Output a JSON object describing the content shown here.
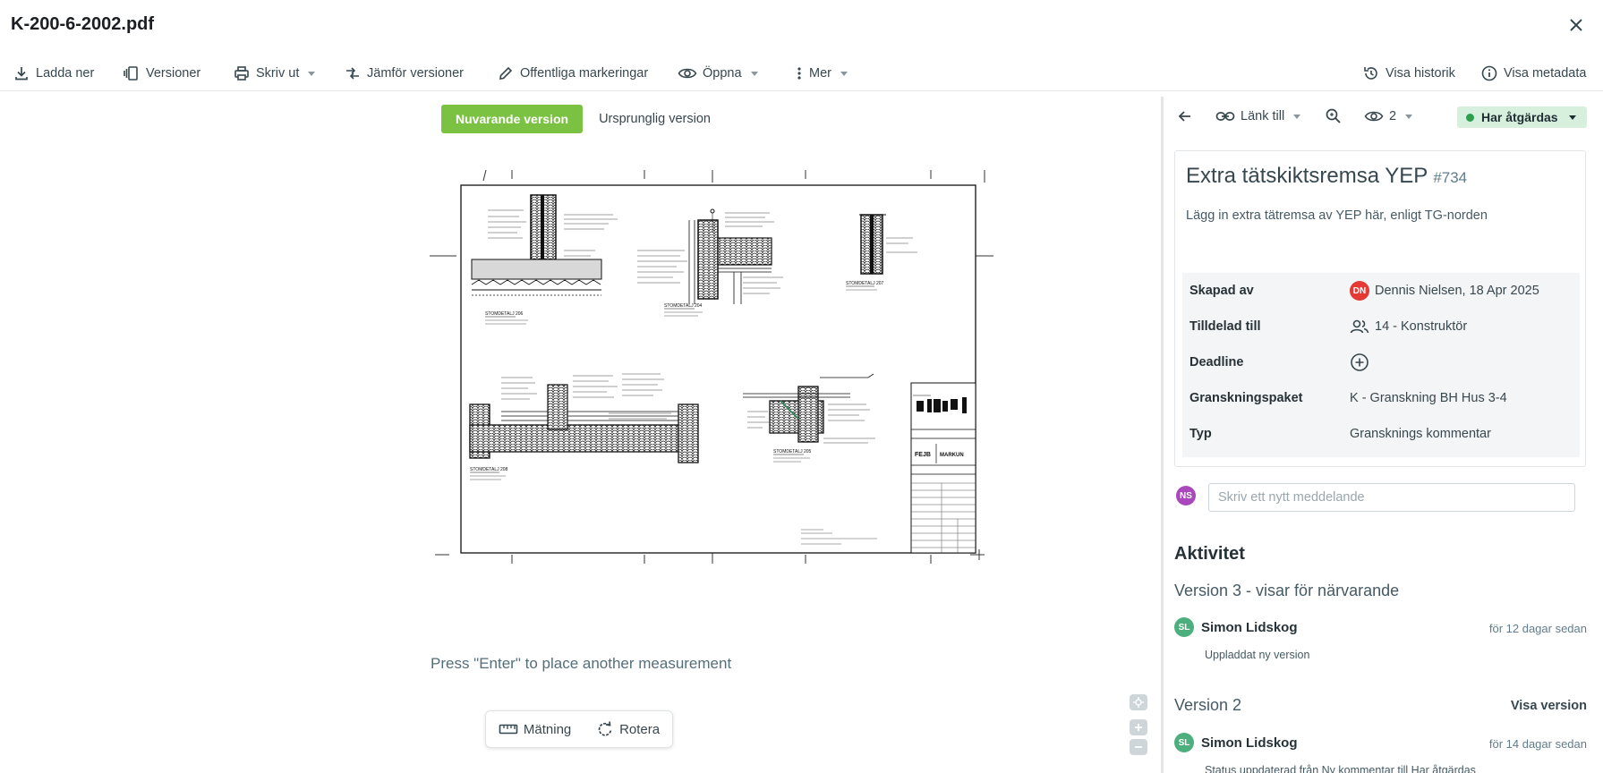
{
  "header": {
    "title": "K-200-6-2002.pdf"
  },
  "toolbar": {
    "download": "Ladda ner",
    "versions": "Versioner",
    "print": "Skriv ut",
    "compare": "Jämför versioner",
    "public_markups": "Offentliga markeringar",
    "open": "Öppna",
    "more": "Mer",
    "history": "Visa historik",
    "metadata": "Visa metadata"
  },
  "viewer": {
    "tab_current": "Nuvarande version",
    "tab_original": "Ursprunglig version",
    "hint": "Press \"Enter\" to place another measurement",
    "tool_measure": "Mätning",
    "tool_rotate": "Rotera",
    "drawing_labels": {
      "d1": "STOMDETALJ 206",
      "d2": "STOMDETALJ 204",
      "d3": "STOMDETALJ 207",
      "d4": "STOMDETALJ 208",
      "d5": "STOMDETALJ 205",
      "logo1": "FEJB",
      "logo2": "MARKUN"
    }
  },
  "panel": {
    "link_to": "Länk till",
    "views": "2",
    "status": "Har åtgärdas",
    "issue": {
      "title": "Extra tätskiktsremsa YEP",
      "number": "#734",
      "description": "Lägg in extra tätremsa av YEP här, enligt TG-norden"
    },
    "props": {
      "created_label": "Skapad av",
      "created_initials": "DN",
      "created_value": "Dennis Nielsen, 18 Apr 2025",
      "assigned_label": "Tilldelad till",
      "assigned_value": "14 - Konstruktör",
      "deadline_label": "Deadline",
      "package_label": "Granskningspaket",
      "package_value": "K - Granskning BH Hus 3-4",
      "type_label": "Typ",
      "type_value": "Gransknings kommentar"
    },
    "composer": {
      "initials": "NS",
      "placeholder": "Skriv ett nytt meddelande"
    },
    "activity": {
      "title": "Aktivitet",
      "v3_title": "Version 3 - visar för närvarande",
      "v3_user_initials": "SL",
      "v3_user": "Simon Lidskog",
      "v3_time": "för 12 dagar sedan",
      "v3_text": "Uppladdat ny version",
      "v2_title": "Version 2",
      "v2_link": "Visa version",
      "v2_user_initials": "SL",
      "v2_user": "Simon Lidskog",
      "v2_time": "för 14 dagar sedan",
      "v2_text": "Status uppdaterad från Ny kommentar till Har åtgärdas"
    }
  },
  "colors": {
    "accent_green": "#7cc242",
    "status_bg": "#d7f0de",
    "status_dot": "#2e9e4f"
  }
}
